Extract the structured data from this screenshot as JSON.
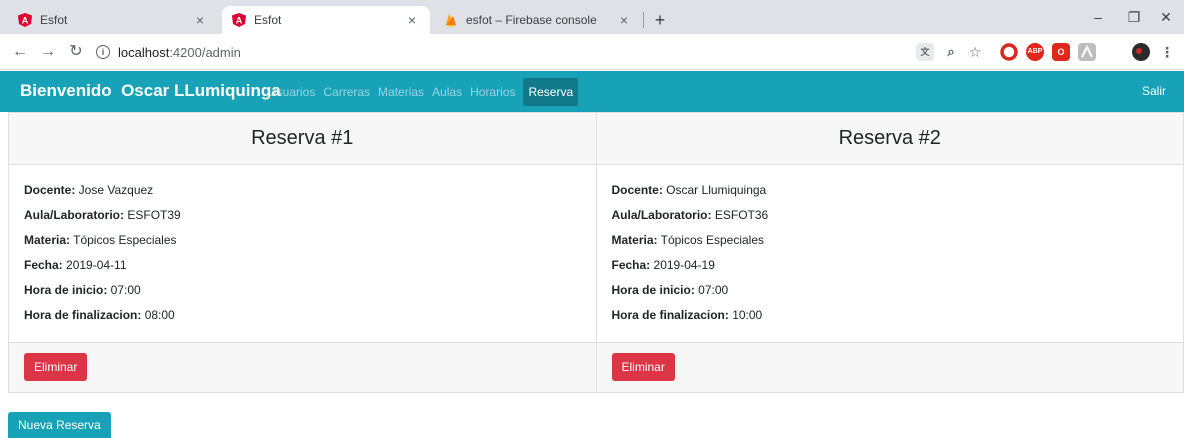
{
  "browser": {
    "tabs": [
      {
        "label": "Esfot",
        "icon": "angular-icon",
        "active": false
      },
      {
        "label": "Esfot",
        "icon": "angular-icon",
        "active": true
      },
      {
        "label": "esfot – Firebase console",
        "icon": "firebase-icon",
        "active": false
      }
    ],
    "url_host": "localhost",
    "url_path": ":4200/admin",
    "extensions": [
      "translate-icon",
      "zoom-icon",
      "star-icon",
      "opera-icon",
      "adblock-icon",
      "office-icon",
      "pdf-icon",
      "avatar-icon",
      "menu-icon"
    ],
    "ext_labels": {
      "adblock": "ABP"
    }
  },
  "navbar": {
    "brand": "Bienvenido  Oscar LLumiquinga",
    "links": [
      "Usuarios",
      "Carreras",
      "Materias",
      "Aulas",
      "Horarios"
    ],
    "active_link": "Reserva",
    "logout": "Salir",
    "color": "#17a2b8"
  },
  "reservas": [
    {
      "title": "Reserva #1",
      "docente_label": "Docente:",
      "docente": " Jose Vazquez",
      "aula_label": "Aula/Laboratorio:",
      "aula": " ESFOT39",
      "materia_label": "Materia:",
      "materia": " Tópicos Especiales",
      "fecha_label": "Fecha:",
      "fecha": " 2019-04-11",
      "inicio_label": "Hora de inicio:",
      "inicio": " 07:00",
      "fin_label": "Hora de finalizacion:",
      "fin": " 08:00",
      "delete": "Eliminar"
    },
    {
      "title": "Reserva #2",
      "docente_label": "Docente:",
      "docente": " Oscar Llumiquinga",
      "aula_label": "Aula/Laboratorio:",
      "aula": " ESFOT36",
      "materia_label": "Materia:",
      "materia": " Tópicos Especiales",
      "fecha_label": "Fecha:",
      "fecha": " 2019-04-19",
      "inicio_label": "Hora de inicio:",
      "inicio": " 07:00",
      "fin_label": "Hora de finalizacion:",
      "fin": " 10:00",
      "delete": "Eliminar"
    }
  ],
  "new_button": "Nueva Reserva",
  "colors": {
    "danger": "#dc3545",
    "info": "#17a2b8"
  }
}
